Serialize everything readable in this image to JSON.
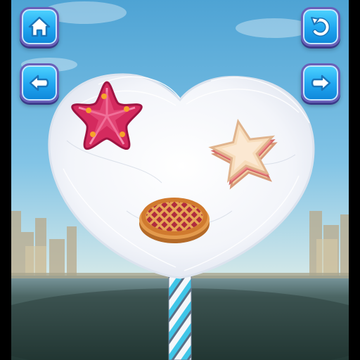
{
  "screen": "cotton-candy-decorating",
  "buttons": {
    "home": {
      "icon": "home-icon"
    },
    "undo": {
      "icon": "undo-icon"
    },
    "back": {
      "icon": "arrow-left-icon"
    },
    "next": {
      "icon": "arrow-right-icon"
    }
  },
  "decorations": [
    {
      "name": "pink-star-candy"
    },
    {
      "name": "star-sandwich"
    },
    {
      "name": "cherry-lattice-pie"
    }
  ],
  "colors": {
    "button_blue": "#1fa5f0",
    "button_border": "#6a5fb8",
    "sky_top": "#4a9fd0",
    "floor": "#3c4f4c",
    "cotton_candy": "#f4f6fb",
    "stick_blue": "#3fc6e8"
  }
}
